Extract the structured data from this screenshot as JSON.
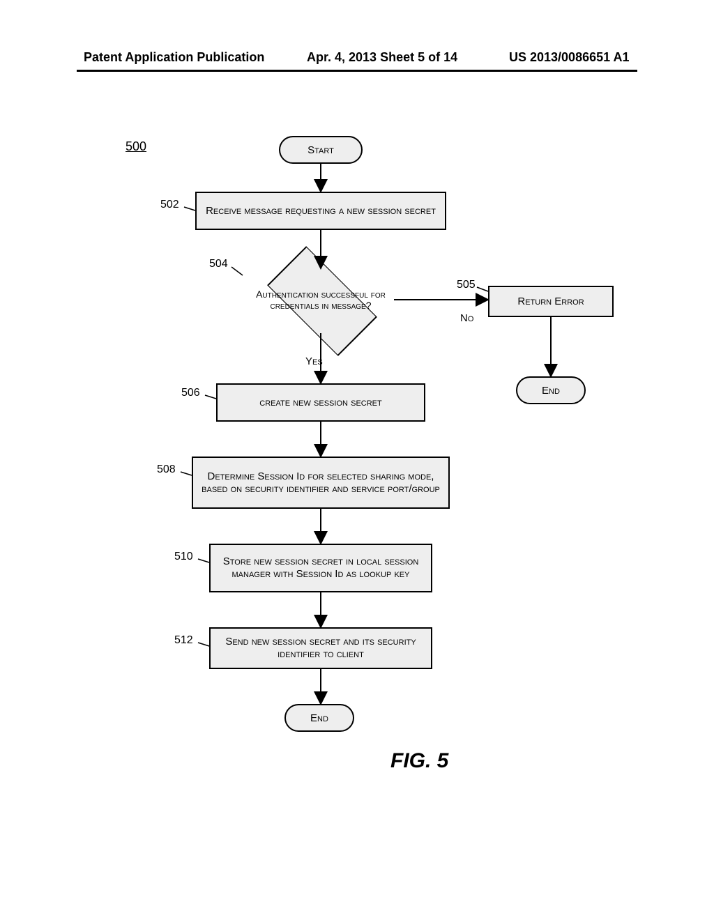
{
  "header": {
    "left": "Patent Application Publication",
    "center": "Apr. 4, 2013  Sheet 5 of 14",
    "right": "US 2013/0086651 A1"
  },
  "diagram": {
    "ref": "500",
    "start": "Start",
    "step502": {
      "ref": "502",
      "text": "Receive message requesting a new session secret"
    },
    "dec504": {
      "ref": "504",
      "text": "Authentication successful for credentials in message?"
    },
    "edge_yes": "Yes",
    "edge_no": "No",
    "step505": {
      "ref": "505",
      "text": "Return Error"
    },
    "step506": {
      "ref": "506",
      "text": "create new session secret"
    },
    "step508": {
      "ref": "508",
      "text": "Determine Session Id for selected sharing mode, based on security identifier and service port/group"
    },
    "step510": {
      "ref": "510",
      "text": "Store new session secret in local session manager with Session Id as lookup key"
    },
    "step512": {
      "ref": "512",
      "text": "Send new session secret and its security identifier to client"
    },
    "end": "End",
    "end2": "End"
  },
  "figure_caption": "FIG. 5"
}
